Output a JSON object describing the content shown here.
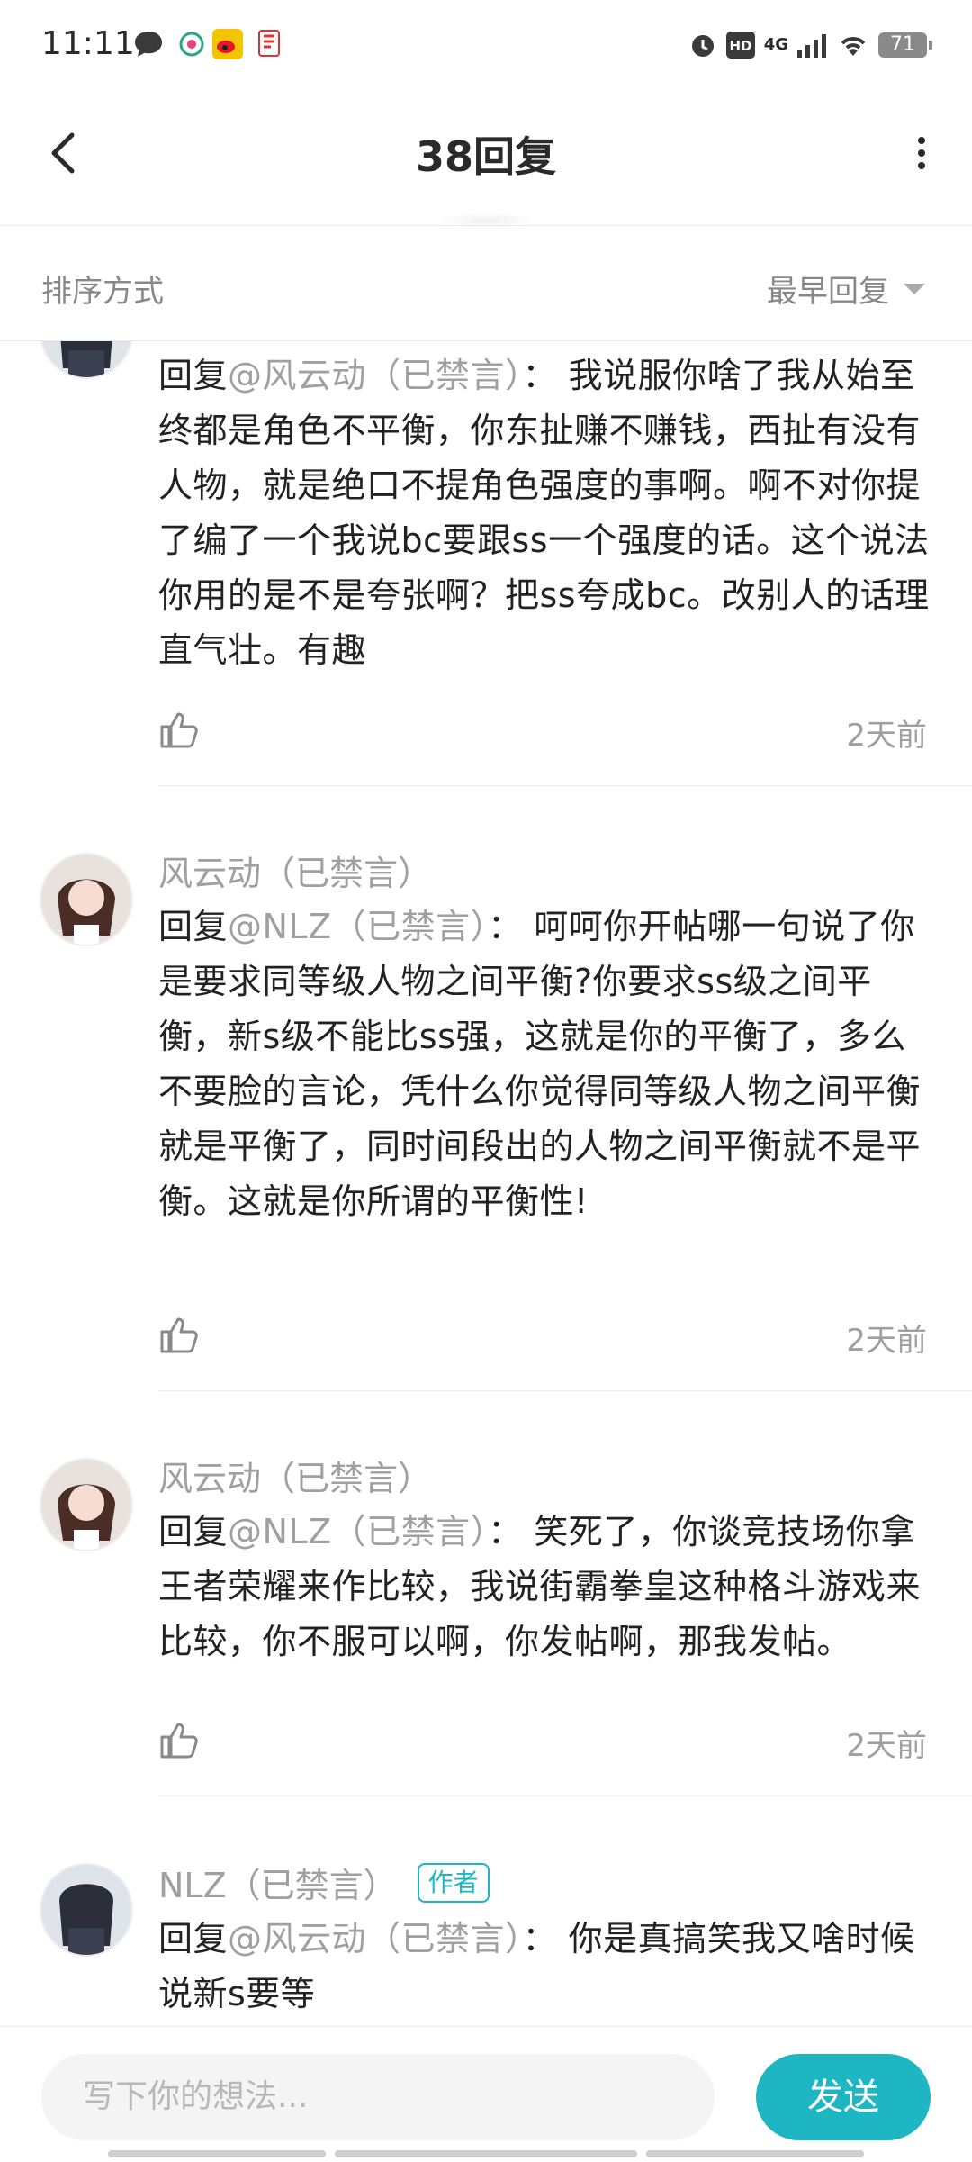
{
  "status_bar": {
    "time": "11:11",
    "battery": "71",
    "network": "4G"
  },
  "header": {
    "title": "38回复"
  },
  "sort": {
    "label": "排序方式",
    "selected": "最早回复"
  },
  "comments": [
    {
      "name": "",
      "reply_prefix": "回复",
      "reply_to": "@风云动（已禁言）",
      "separator": "：",
      "text": "我说服你啥了我从始至终都是角色不平衡，你东扯赚不赚钱，西扯有没有人物，就是绝口不提角色强度的事啊。啊不对你提了编了一个我说bc要跟ss一个强度的话。这个说法你用的是不是夸张啊？把ss夸成bc。改别人的话理直气壮。有趣",
      "time": "2天前"
    },
    {
      "name": "风云动（已禁言）",
      "reply_prefix": "回复",
      "reply_to": "@NLZ（已禁言）",
      "separator": "：",
      "text": "呵呵你开帖哪一句说了你是要求同等级人物之间平衡?你要求ss级之间平衡，新s级不能比ss强，这就是你的平衡了，多么不要脸的言论，凭什么你觉得同等级人物之间平衡就是平衡了，同时间段出的人物之间平衡就不是平衡。这就是你所谓的平衡性!",
      "time": "2天前"
    },
    {
      "name": "风云动（已禁言）",
      "reply_prefix": "回复",
      "reply_to": "@NLZ（已禁言）",
      "separator": "：",
      "text": "笑死了，你谈竞技场你拿王者荣耀来作比较，我说街霸拳皇这种格斗游戏来比较，你不服可以啊，你发帖啊，那我发帖。",
      "time": "2天前"
    },
    {
      "name": "NLZ（已禁言）",
      "tag": "作者",
      "reply_prefix": "回复",
      "reply_to": "@风云动（已禁言）",
      "separator": "：",
      "text": "你是真搞笑我又啥时候说新s要等"
    }
  ],
  "input": {
    "placeholder": "写下你的想法...",
    "send_label": "发送"
  },
  "colors": {
    "accent": "#1fb6c3",
    "muted_text": "#a0a0a0",
    "body_text": "#222222"
  }
}
